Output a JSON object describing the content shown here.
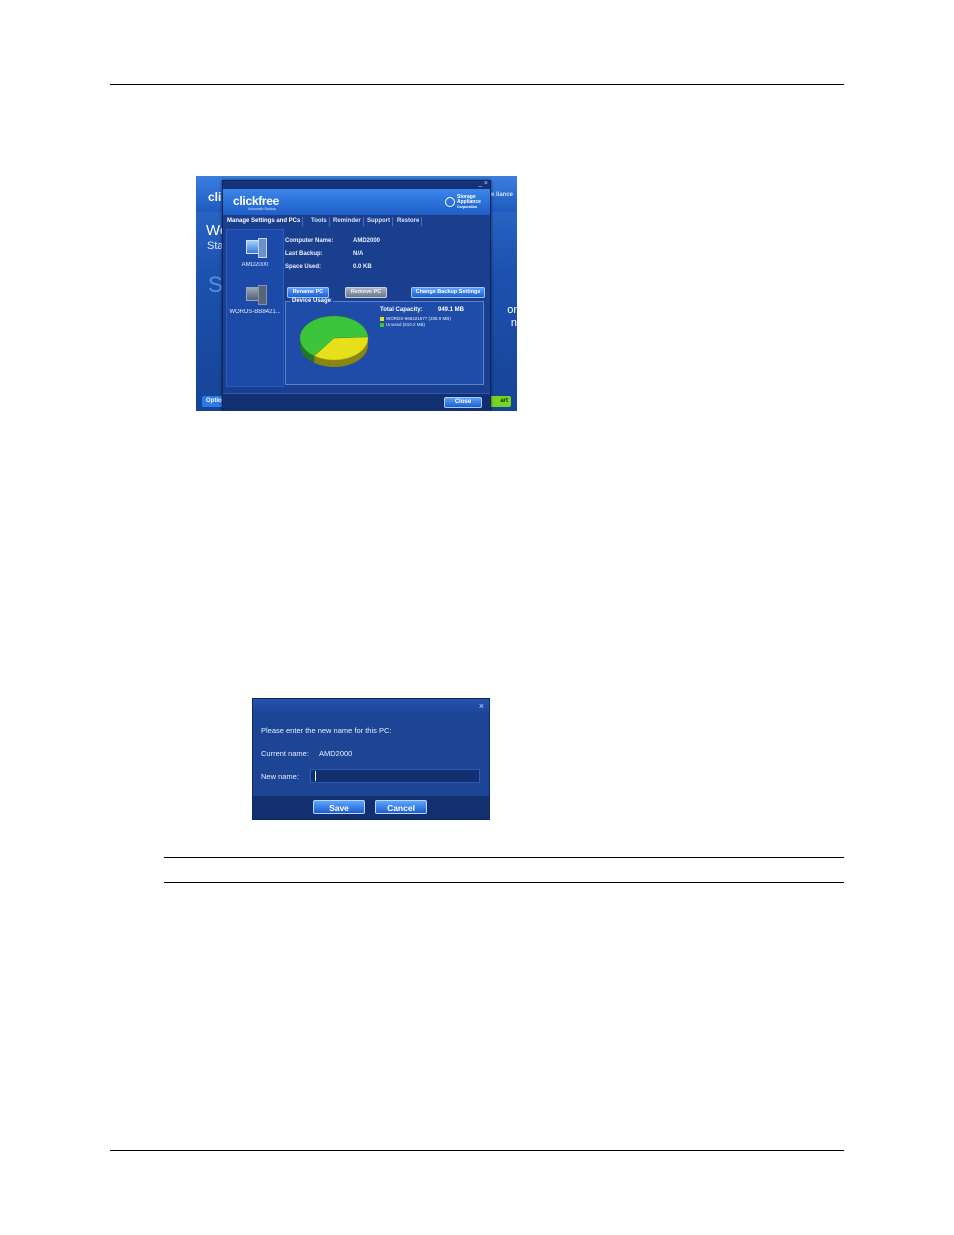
{
  "background_window": {
    "logo": "cli",
    "logo_right": "rage liance",
    "heading_fragment": "We",
    "subheading_fragment": "Sta",
    "faded_fragment": "S",
    "right_text_line1": "or",
    "right_text_line2": "n",
    "options_button": "Optio",
    "start_button": "art"
  },
  "clickfree_window": {
    "logo": "clickfree",
    "tagline": "Automatic Backup",
    "brand_line1": "Storage",
    "brand_line2": "Appliance",
    "brand_line3": "Corporation",
    "window_controls": "_ ×",
    "tabs": [
      {
        "label": "Manage Settings and PCs"
      },
      {
        "label": "Tools"
      },
      {
        "label": "Reminder"
      },
      {
        "label": "Support"
      },
      {
        "label": "Restore"
      }
    ],
    "pcs": [
      {
        "label": "AMD2000"
      },
      {
        "label": "WORDS-BB8421..."
      }
    ],
    "info": {
      "computer_name_label": "Computer Name:",
      "computer_name_value": "AMD2000",
      "last_backup_label": "Last Backup:",
      "last_backup_value": "N/A",
      "space_used_label": "Space Used:",
      "space_used_value": "0.0 KB"
    },
    "buttons": {
      "rename": "Rename PC",
      "remove": "Remove PC",
      "change_settings": "Change Backup Settings",
      "close": "Close"
    },
    "device_usage": {
      "title": "Device Usage",
      "total_capacity_label": "Total Capacity:",
      "total_capacity_value": "949.1 MB",
      "legend": [
        {
          "label": "WORDS-668421577 (338.9 MB)",
          "color": "#e6e01a"
        },
        {
          "label": "Unused (610.2 MB)",
          "color": "#3cc43c"
        }
      ]
    }
  },
  "rename_dialog": {
    "close_icon": "×",
    "prompt": "Please enter the new name for this PC:",
    "current_name_label": "Current name:",
    "current_name_value": "AMD2000",
    "new_name_label": "New name:",
    "new_name_value": "",
    "save_button": "Save",
    "cancel_button": "Cancel"
  },
  "chart_data": {
    "type": "pie",
    "title": "",
    "slices": [
      {
        "label": "WORDS-668421577",
        "value": 338.9,
        "color": "#e6e01a"
      },
      {
        "label": "Unused",
        "value": 610.2,
        "color": "#3cc43c"
      }
    ]
  }
}
